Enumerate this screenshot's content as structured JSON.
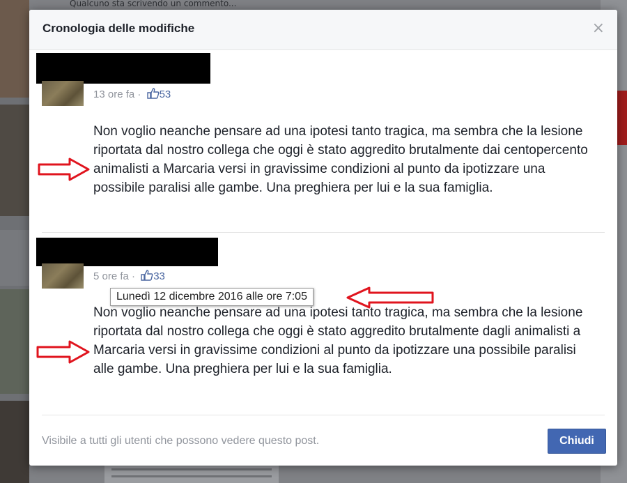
{
  "background": {
    "topbar_text": "Qualcuno sta scrivendo un commento..."
  },
  "dialog": {
    "title": "Cronologia delle modifiche",
    "close_icon": "close-icon",
    "footer_text": "Visibile a tutti gli utenti che possono vedere questo post.",
    "close_button_label": "Chiudi"
  },
  "revisions": [
    {
      "time": "13 ore fa",
      "separator": "·",
      "likes": "53",
      "text": "Non voglio neanche pensare ad una ipotesi tanto tragica, ma sembra che la lesione riportata dal nostro collega che oggi è stato aggredito brutalmente dai centopercento animalisti a Marcaria versi in gravissime condizioni al punto da ipotizzare una possibile paralisi alle gambe. Una preghiera per lui e la sua famiglia."
    },
    {
      "time": "5 ore fa",
      "separator": "·",
      "likes": "33",
      "text": "Non voglio neanche pensare ad una ipotesi tanto tragica, ma sembra che la lesione riportata dal nostro collega che oggi è stato aggredito brutalmente dagli animalisti a Marcaria versi in gravissime condizioni al punto da ipotizzare una possibile paralisi alle gambe. Una preghiera per lui e la sua famiglia."
    }
  ],
  "tooltip": {
    "text": "Lunedì 12 dicembre 2016 alle ore 7:05"
  },
  "annotations": {
    "arrow_color": "#e0141e",
    "redaction_color": "#000000"
  },
  "colors": {
    "accent": "#4267b2",
    "meta_text": "#90949c",
    "like_text": "#4b67a1"
  }
}
